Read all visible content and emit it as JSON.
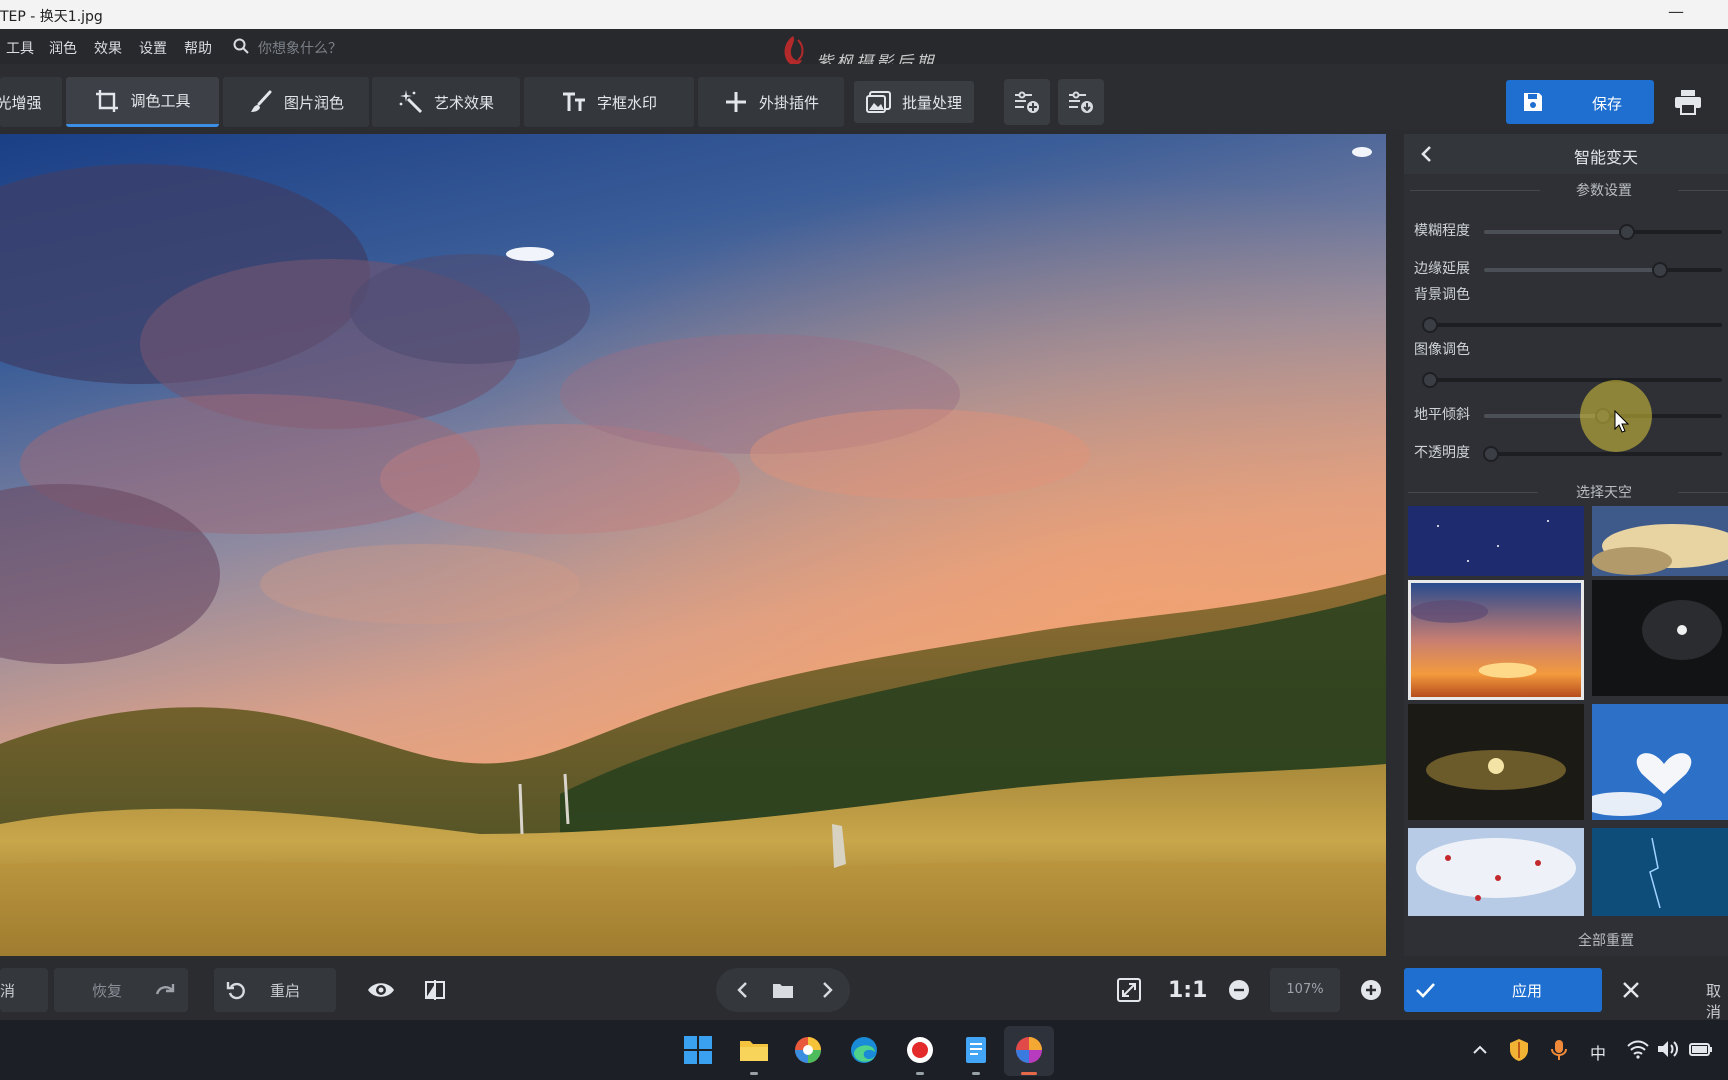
{
  "window": {
    "title": "TEP - 换天1.jpg",
    "minimize": "—"
  },
  "menu": {
    "items": [
      "工具",
      "润色",
      "效果",
      "设置",
      "帮助"
    ],
    "search_placeholder": "你想象什么？",
    "watermark": "紫枫摄影后期"
  },
  "toolbar": {
    "tabs": [
      {
        "label": "光增强",
        "icon": "enhance-icon"
      },
      {
        "label": "调色工具",
        "icon": "crop-icon",
        "active": true
      },
      {
        "label": "图片润色",
        "icon": "brush-icon"
      },
      {
        "label": "艺术效果",
        "icon": "magic-wand-icon"
      },
      {
        "label": "字框水印",
        "icon": "text-icon"
      },
      {
        "label": "外掛插件",
        "icon": "plus-icon"
      },
      {
        "label": "批量处理",
        "icon": "images-icon"
      }
    ],
    "save_label": "保存",
    "accent": "#1f6fd0"
  },
  "panel": {
    "title": "智能变天",
    "section_params": "参数设置",
    "sliders": [
      {
        "label": "模糊程度",
        "value": 0.6
      },
      {
        "label": "边缘延展",
        "value": 0.74
      },
      {
        "label": "背景调色",
        "value": 0.0
      },
      {
        "label": "图像调色",
        "value": 0.0
      },
      {
        "label": "地平倾斜",
        "value": 0.5
      },
      {
        "label": "不透明度",
        "value": 0.03
      }
    ],
    "section_sky": "选择天空",
    "reset_all": "全部重置"
  },
  "bottom": {
    "undo_partial": "消",
    "redo_label": "恢复",
    "restart_label": "重启",
    "zoom_ratio": "1:1",
    "zoom_value": "107%",
    "apply_label": "应用",
    "cancel_label": "取消"
  },
  "taskbar": {
    "tray_ime": "中"
  }
}
